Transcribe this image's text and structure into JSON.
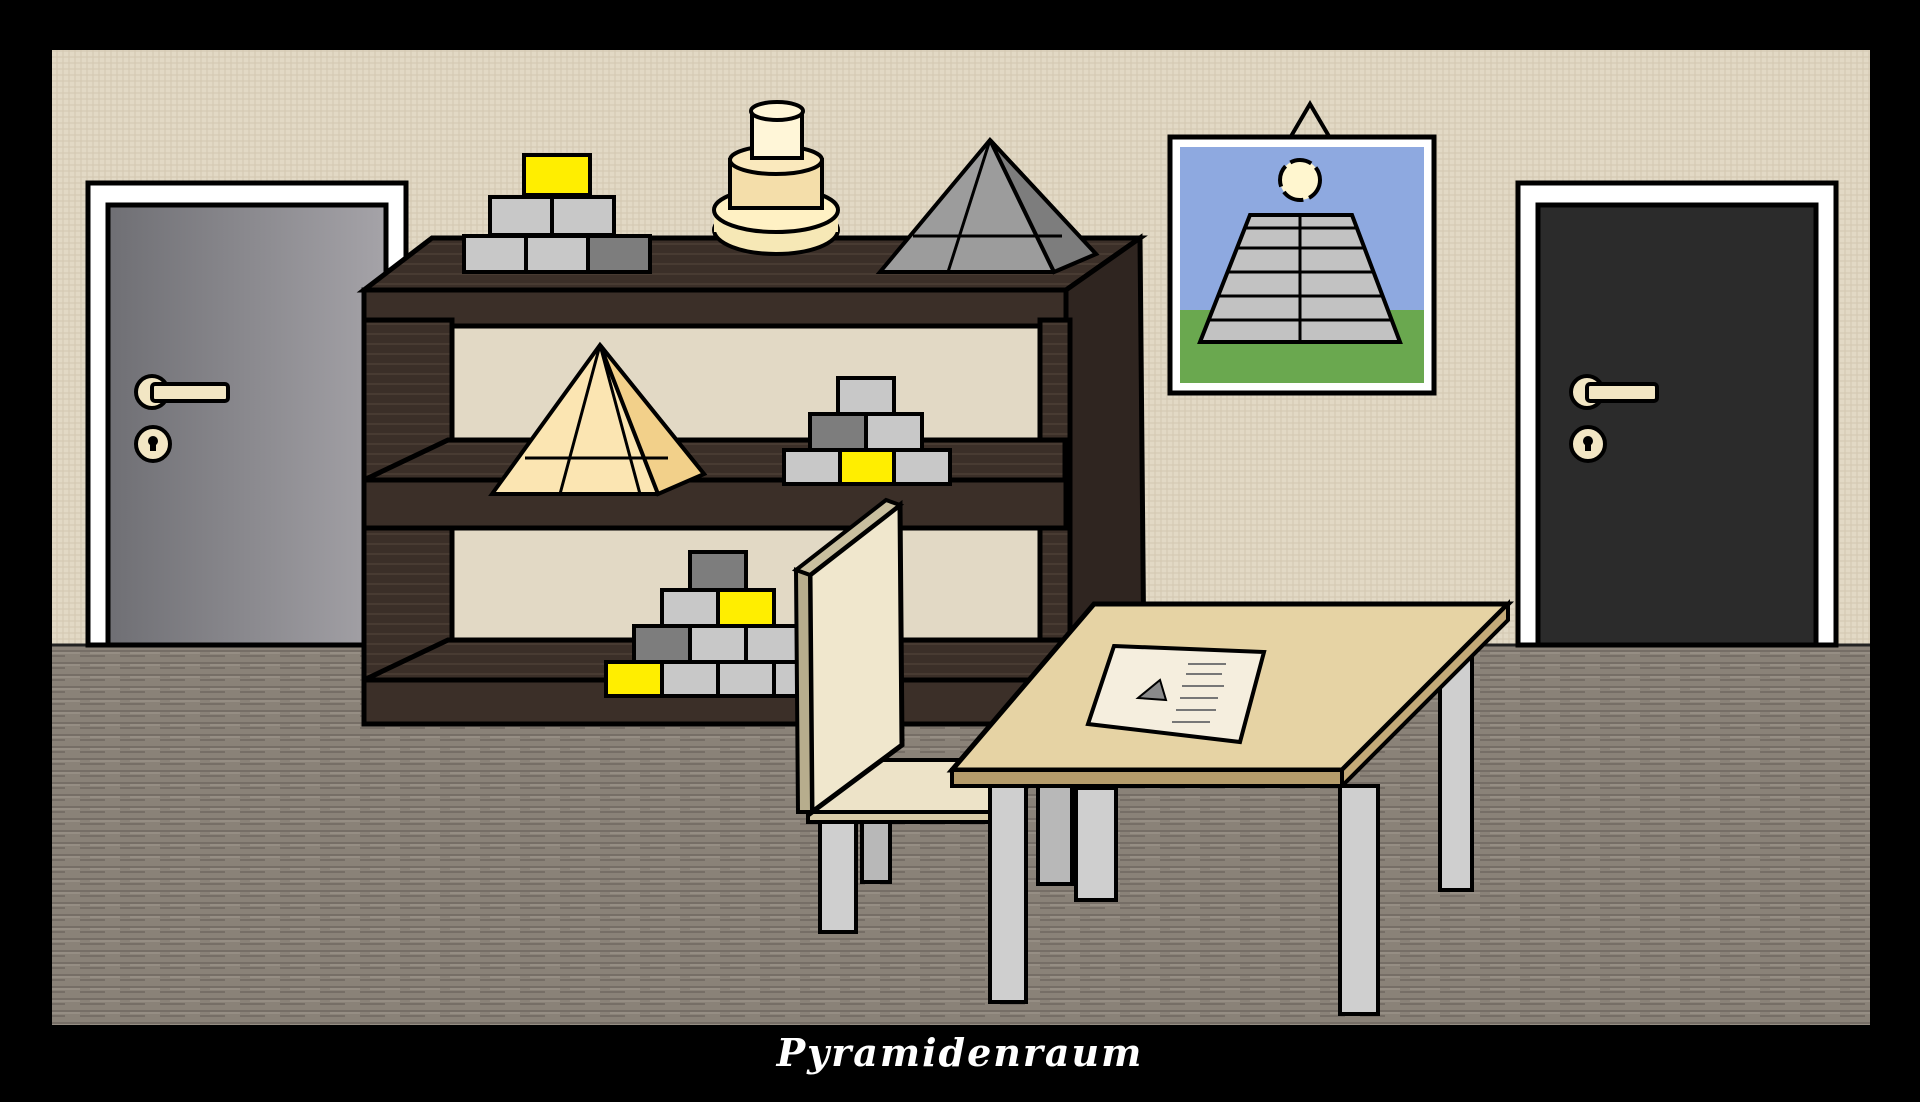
{
  "scene": {
    "caption": "Pyramidenraum",
    "objects": [
      "door-left",
      "door-right",
      "shelf",
      "block-pyramid-top-shelf",
      "cylinder-tower",
      "grey-pyramid",
      "cream-pyramid",
      "block-pyramid-middle-shelf",
      "block-pyramid-bottom-shelf",
      "wall-poster",
      "chair",
      "table",
      "paper-note"
    ]
  },
  "colors": {
    "wall": "#e2d9c5",
    "floor": "#8a8278",
    "shelf": "#3b2f28",
    "door_left": "#7a7a7e",
    "door_right": "#2b2b2b",
    "door_frame": "#ffffff",
    "handle": "#f2e6c4",
    "block_grey": "#c8c8c8",
    "block_dark": "#7d7d7d",
    "block_yellow": "#ffee00",
    "table_top": "#e6d3a4",
    "table_leg": "#cfcfcf",
    "poster_sky": "#8ea9e0",
    "poster_grass": "#6aa84f"
  }
}
